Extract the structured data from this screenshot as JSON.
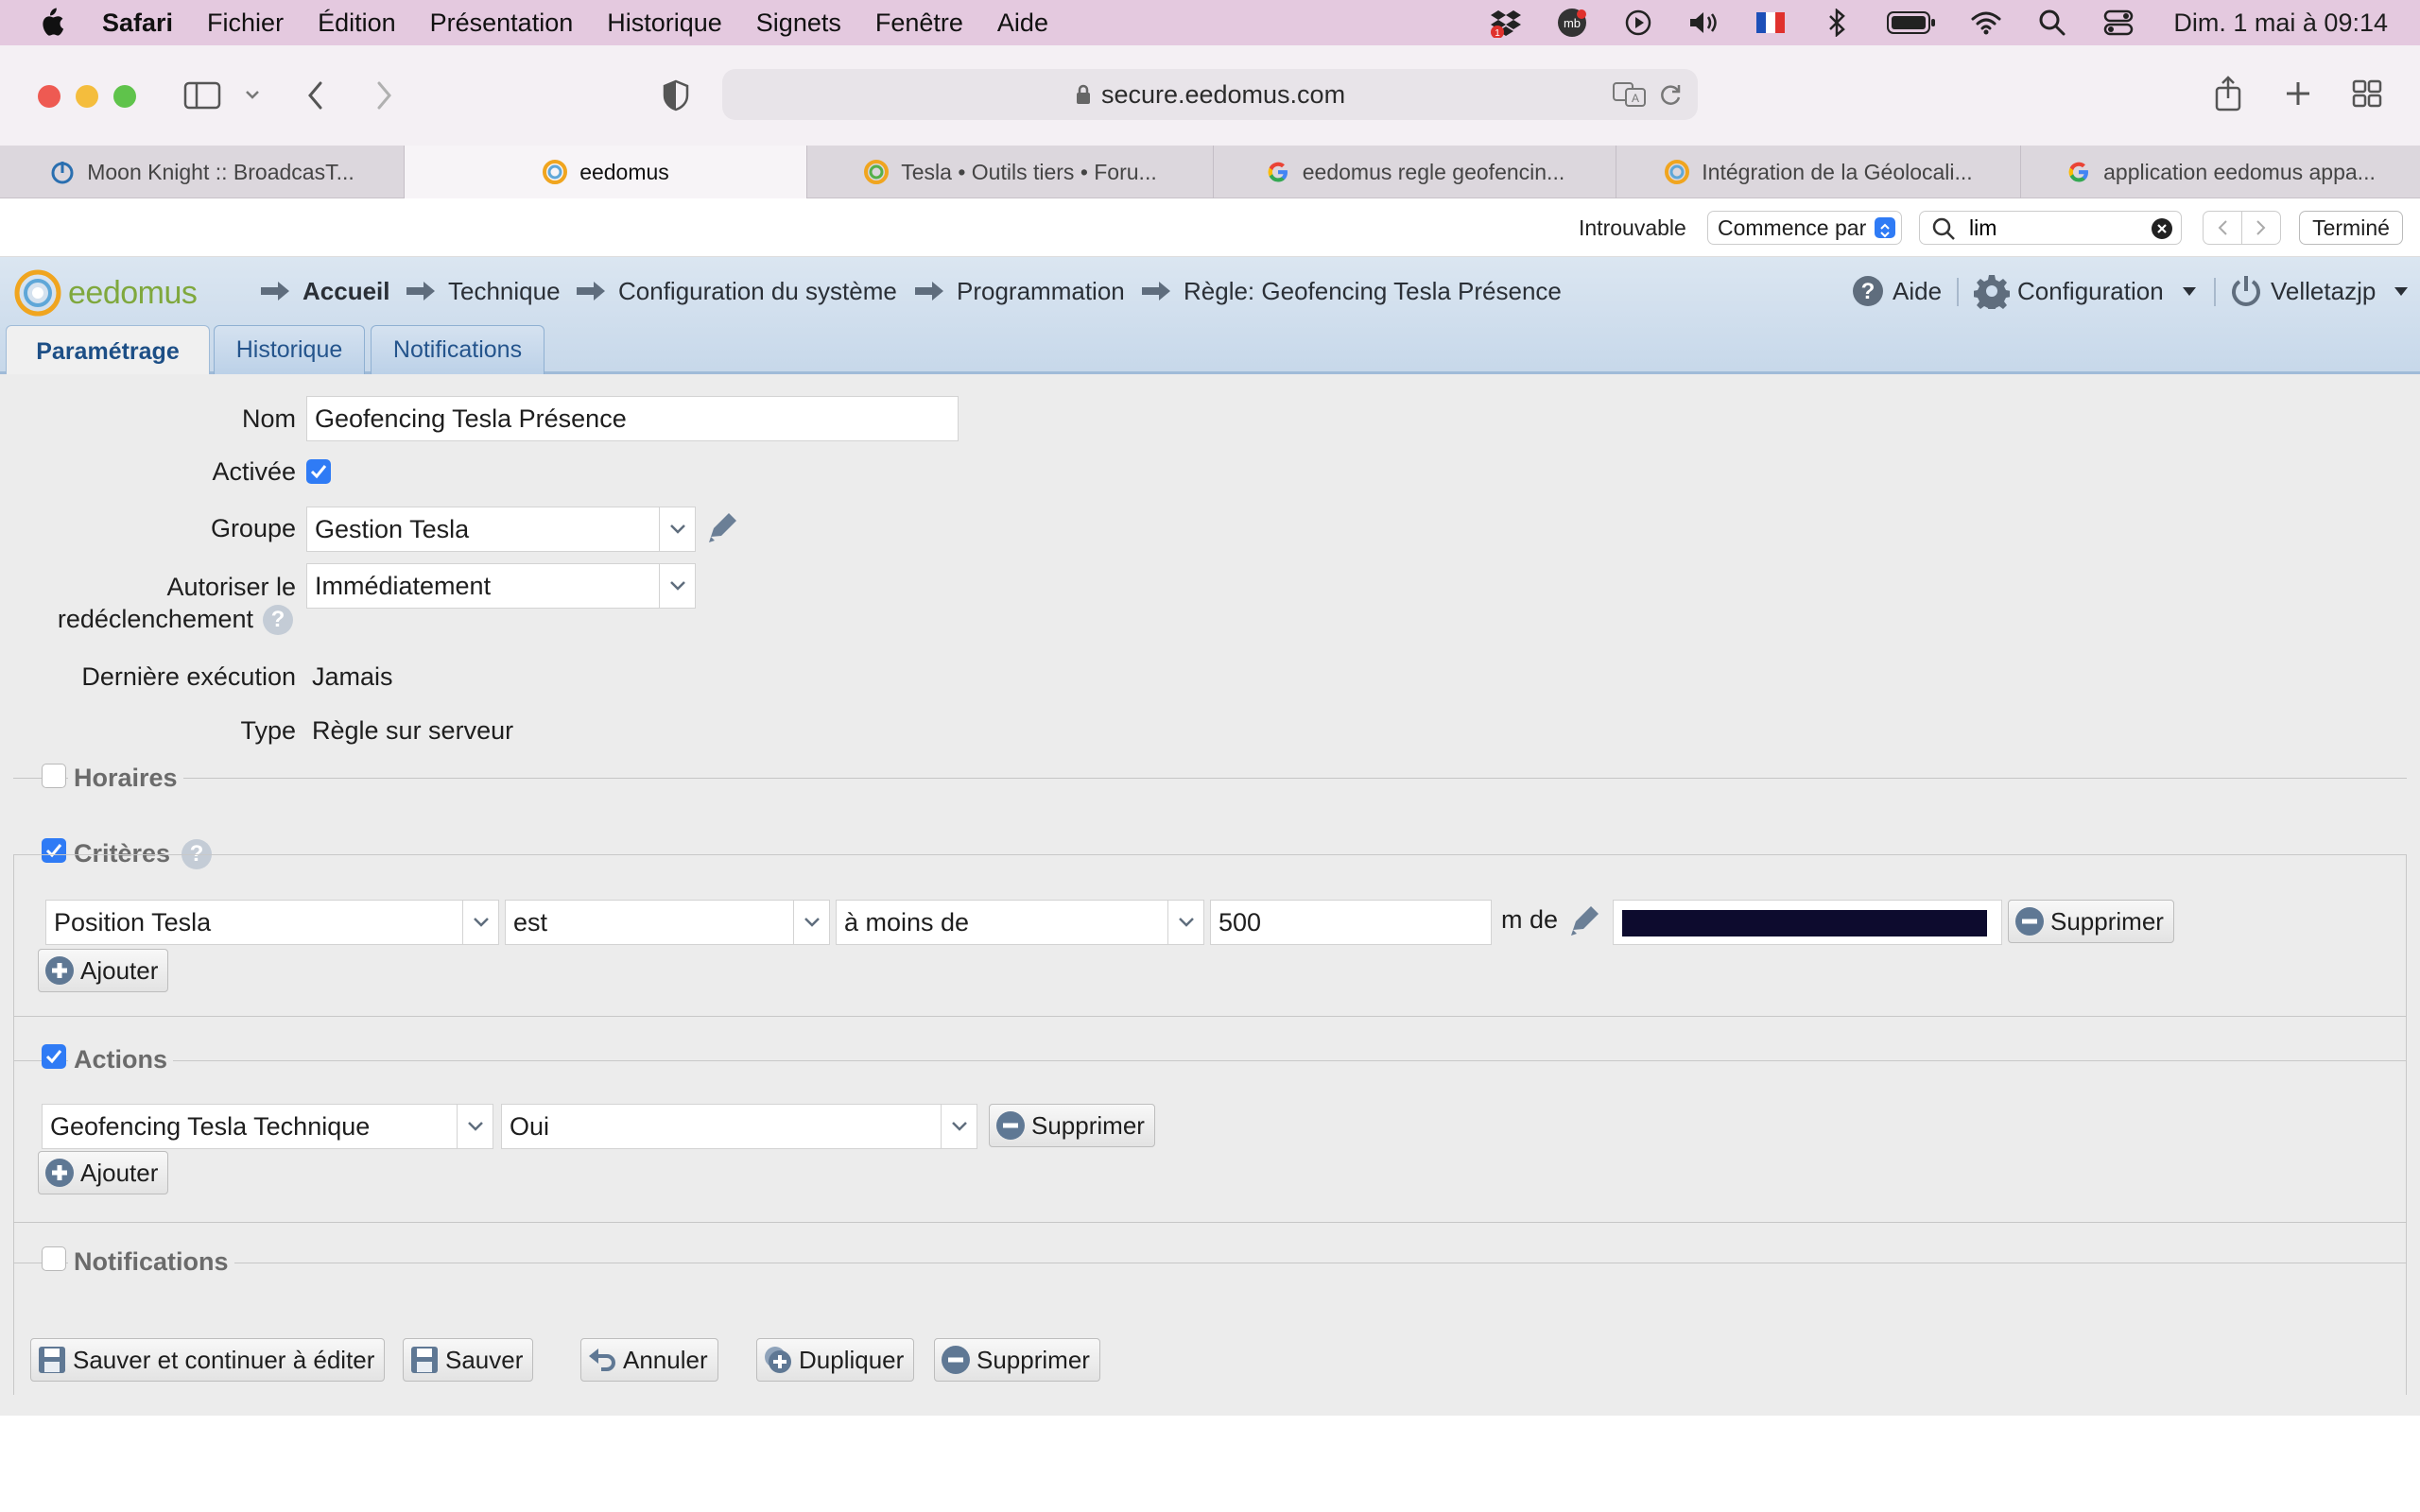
{
  "menubar": {
    "app": "Safari",
    "items": [
      "Fichier",
      "Édition",
      "Présentation",
      "Historique",
      "Signets",
      "Fenêtre",
      "Aide"
    ],
    "clock": "Dim. 1 mai à  09:14"
  },
  "browser": {
    "url": "secure.eedomus.com",
    "tabs": [
      {
        "label": "Moon Knight :: BroadcasT..."
      },
      {
        "label": "eedomus"
      },
      {
        "label": "Tesla • Outils tiers • Foru..."
      },
      {
        "label": "eedomus regle geofencin..."
      },
      {
        "label": "Intégration de la Géolocali..."
      },
      {
        "label": "application eedomus appa..."
      }
    ],
    "find": {
      "status": "Introuvable",
      "mode": "Commence par",
      "query": "lim",
      "done": "Terminé"
    }
  },
  "app": {
    "logo": "eedomus",
    "breadcrumb": [
      "Accueil",
      "Technique",
      "Configuration du système",
      "Programmation",
      "Règle: Geofencing Tesla Présence"
    ],
    "help": "Aide",
    "config": "Configuration",
    "user": "Velletazjp",
    "tabs": [
      "Paramétrage",
      "Historique",
      "Notifications"
    ]
  },
  "form": {
    "name_label": "Nom",
    "name_value": "Geofencing Tesla Présence",
    "active_label": "Activée",
    "group_label": "Groupe",
    "group_value": "Gestion Tesla",
    "retrigger_label_1": "Autoriser le",
    "retrigger_label_2": "redéclenchement",
    "retrigger_value": "Immédiatement",
    "last_exec_label": "Dernière exécution",
    "last_exec_value": "Jamais",
    "type_label": "Type",
    "type_value": "Règle sur serveur"
  },
  "sections": {
    "horaires": "Horaires",
    "criteres": "Critères",
    "actions": "Actions",
    "notifications": "Notifications"
  },
  "criteria": [
    {
      "device": "Position Tesla",
      "operator": "est",
      "condition": "à moins de",
      "value": "500",
      "unit": "m de",
      "delete": "Supprimer"
    }
  ],
  "actions": [
    {
      "device": "Geofencing Tesla Technique",
      "value": "Oui",
      "delete": "Supprimer"
    }
  ],
  "add_label": "Ajouter",
  "footer_buttons": {
    "save_continue": "Sauver et continuer à éditer",
    "save": "Sauver",
    "cancel": "Annuler",
    "duplicate": "Dupliquer",
    "delete": "Supprimer"
  },
  "colors": {
    "menubar": "#e4c9df",
    "accent_blue": "#2f7bf5",
    "header_blue": "#c7d8ea",
    "logo_green": "#7fa83d",
    "redacted": "#0d0b2e"
  }
}
